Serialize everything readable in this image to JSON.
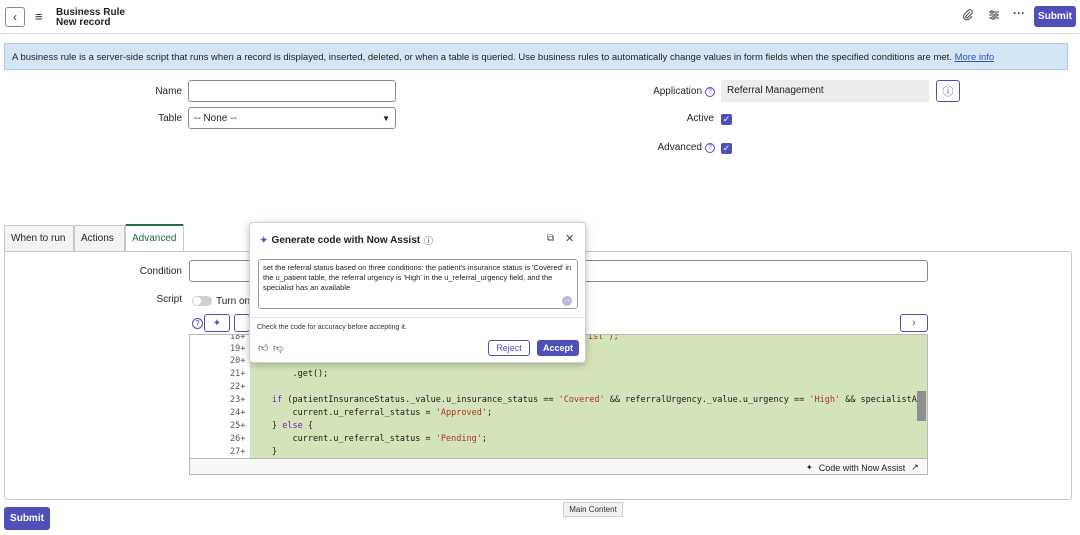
{
  "header": {
    "title_line1": "Business Rule",
    "title_line2": "New record",
    "submit_label": "Submit"
  },
  "banner": {
    "text": "A business rule is a server-side script that runs when a record is displayed, inserted, deleted, or when a table is queried. Use business rules to automatically change values in form fields when the specified conditions are met. ",
    "link": "More info"
  },
  "form": {
    "name_label": "Name",
    "name_value": "",
    "table_label": "Table",
    "table_value": "-- None --",
    "application_label": "Application",
    "application_value": "Referral Management",
    "active_label": "Active",
    "advanced_label": "Advanced"
  },
  "tabs": [
    {
      "label": "When to run"
    },
    {
      "label": "Actions"
    },
    {
      "label": "Advanced"
    }
  ],
  "advanced": {
    "condition_label": "Condition",
    "script_label": "Script",
    "turn_on_label": "Turn on"
  },
  "code": {
    "lines": [
      {
        "n": "18+",
        "text": ""
      },
      {
        "n": "19+",
        "text": ""
      },
      {
        "n": "20+",
        "text": ""
      },
      {
        "n": "21+",
        "text": "    .get();"
      },
      {
        "n": "22+",
        "text": ""
      },
      {
        "n": "23+",
        "text": "if (patientInsuranceStatus._value.u_insurance_status == 'Covered' && referralUrgency._value.u_urgency == 'High' && specialistA"
      },
      {
        "n": "24+",
        "text": "    current.u_referral_status = 'Approved';"
      },
      {
        "n": "25+",
        "text": "} else {"
      },
      {
        "n": "26+",
        "text": "    current.u_referral_status = 'Pending';"
      },
      {
        "n": "27+",
        "text": "}"
      }
    ],
    "partial_top": "ist');",
    "footer_label": "Code with Now Assist"
  },
  "popup": {
    "title": "Generate code with Now Assist",
    "prompt": "set the referral status based on three conditions: the patient's insurance status is 'Covered' in the u_patient table, the referral urgency is 'High' in the u_referral_urgency field, and the specialist has an available",
    "disclaimer": "Check the code for accuracy before accepting it.",
    "reject_label": "Reject",
    "accept_label": "Accept"
  },
  "footer": {
    "submit_label": "Submit",
    "tooltip": "Main Content"
  },
  "colors": {
    "accent": "#4e4fb8",
    "code_bg": "#d4e4ba",
    "banner_bg": "#d4e6f5",
    "active_tab": "#1b6f3a"
  }
}
